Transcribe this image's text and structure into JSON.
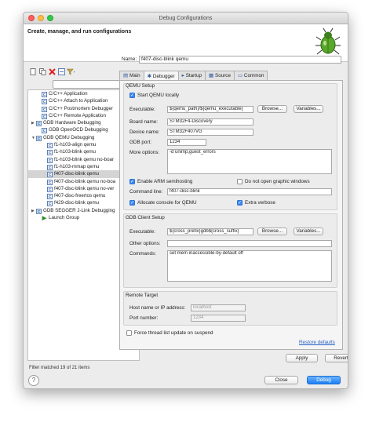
{
  "window": {
    "title": "Debug Configurations"
  },
  "header": {
    "title": "Create, manage, and run configurations"
  },
  "toolbar": {
    "icons": [
      "new-config-icon",
      "duplicate-icon",
      "delete-icon",
      "collapse-icon",
      "filter-icon"
    ]
  },
  "tree": {
    "items": [
      {
        "label": "C/C++ Application",
        "indent": 1,
        "icon": "c-icon",
        "arrow": ""
      },
      {
        "label": "C/C++ Attach to Application",
        "indent": 1,
        "icon": "c-icon",
        "arrow": ""
      },
      {
        "label": "C/C++ Postmortem Debugger",
        "indent": 1,
        "icon": "c-icon",
        "arrow": ""
      },
      {
        "label": "C/C++ Remote Application",
        "indent": 1,
        "icon": "c-icon",
        "arrow": ""
      },
      {
        "label": "GDB Hardware Debugging",
        "indent": 0,
        "icon": "c-icon",
        "arrow": "▶"
      },
      {
        "label": "GDB OpenOCD Debugging",
        "indent": 1,
        "icon": "c-icon",
        "arrow": ""
      },
      {
        "label": "GDB QEMU Debugging",
        "indent": 0,
        "icon": "c-icon",
        "arrow": "▼"
      },
      {
        "label": "f1-h103-align qemu",
        "indent": 2,
        "icon": "c-icon",
        "arrow": ""
      },
      {
        "label": "f1-h103-blink qemu",
        "indent": 2,
        "icon": "c-icon",
        "arrow": ""
      },
      {
        "label": "f1-h103-blink qemu no-boar",
        "indent": 2,
        "icon": "c-icon",
        "arrow": ""
      },
      {
        "label": "f1-h103-mmap qemu",
        "indent": 2,
        "icon": "c-icon",
        "arrow": ""
      },
      {
        "label": "f407-disc-blink qemu",
        "indent": 2,
        "icon": "c-icon",
        "arrow": "",
        "selected": true
      },
      {
        "label": "f407-disc-blink qemu no-boa",
        "indent": 2,
        "icon": "c-icon",
        "arrow": ""
      },
      {
        "label": "f407-disc-blink qemu no-ver",
        "indent": 2,
        "icon": "c-icon",
        "arrow": ""
      },
      {
        "label": "f407-disc-freertos qemu",
        "indent": 2,
        "icon": "c-icon",
        "arrow": ""
      },
      {
        "label": "f429-disc-blink qemu",
        "indent": 2,
        "icon": "c-icon",
        "arrow": ""
      },
      {
        "label": "GDB SEGGER J-Link Debugging",
        "indent": 0,
        "icon": "c-icon",
        "arrow": "▶"
      },
      {
        "label": "Launch Group",
        "indent": 1,
        "icon": "launch-icon",
        "arrow": ""
      }
    ],
    "filter_status": "Filter matched 19 of 21 items"
  },
  "config": {
    "name_label": "Name:",
    "name_value": "f407-disc-blink qemu",
    "tabs": [
      {
        "label": "Main",
        "icon": "main-tab-icon",
        "active": false
      },
      {
        "label": "Debugger",
        "icon": "debugger-tab-icon",
        "active": true
      },
      {
        "label": "Startup",
        "icon": "startup-tab-icon",
        "active": false
      },
      {
        "label": "Source",
        "icon": "source-tab-icon",
        "active": false
      },
      {
        "label": "Common",
        "icon": "common-tab-icon",
        "active": false
      }
    ]
  },
  "qemu": {
    "group_title": "QEMU Setup",
    "start_locally": "Start QEMU locally",
    "executable_label": "Executable:",
    "executable_value": "${qemu_path}/${qemu_executable}",
    "browse": "Browse...",
    "variables": "Variables...",
    "board_label": "Board name:",
    "board_value": "STM32F4-Discovery",
    "device_label": "Device name:",
    "device_value": "STM32F407VG",
    "port_label": "GDB port:",
    "port_value": "1234",
    "options_label": "More options:",
    "options_value": "-d unimp,guest_errors",
    "semihosting": "Enable ARM semihosting",
    "no_graphic": "Do not open graphic windows",
    "cmdline_label": "Command line:",
    "cmdline_value": "f407-disc-blink",
    "allocate_console": "Allocate console for QEMU",
    "extra_verbose": "Extra verbose"
  },
  "gdb": {
    "group_title": "GDB Client Setup",
    "executable_label": "Executable:",
    "executable_value": "${cross_prefix}gdb${cross_suffix}",
    "browse": "Browse...",
    "variables": "Variables...",
    "options_label": "Other options:",
    "options_value": "",
    "commands_label": "Commands:",
    "commands_value": "set mem inaccessible-by-default off"
  },
  "remote": {
    "group_title": "Remote Target",
    "host_label": "Host name or IP address:",
    "host_value": "localhost",
    "port_label": "Port number:",
    "port_value": "1234"
  },
  "force_thread": "Force thread list update on suspend",
  "restore_defaults": "Restore defaults",
  "buttons": {
    "apply": "Apply",
    "revert": "Revert",
    "close": "Close",
    "debug": "Debug",
    "help": "?"
  }
}
